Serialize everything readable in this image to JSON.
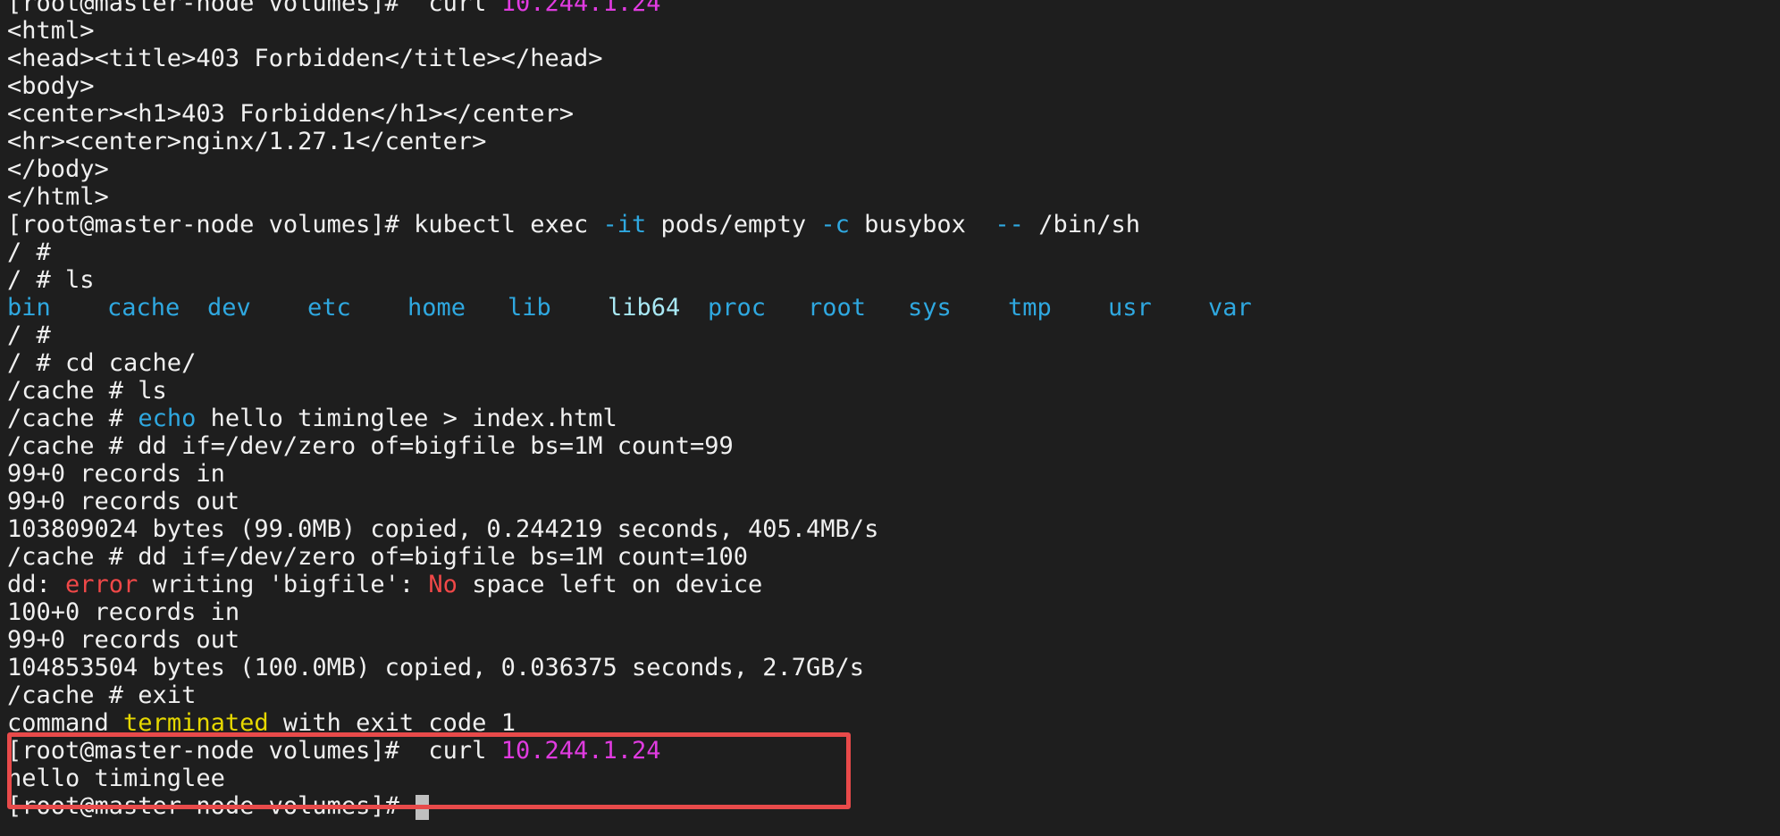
{
  "terminal": {
    "prompt": "[root@master-node volumes]#",
    "colors": {
      "background": "#1e1e1e",
      "text": "#f0f0f0",
      "ip": "#e03be0",
      "flag": "#2fa8e0",
      "error": "#f04848",
      "warning": "#e6d800",
      "highlight_box": "#e84a4a"
    },
    "curl_cmd": "  curl ",
    "ip": "10.244.1.24",
    "html_lines": [
      "<html>",
      "<head><title>403 Forbidden</title></head>",
      "<body>",
      "<center><h1>403 Forbidden</h1></center>",
      "<hr><center>nginx/1.27.1</center>",
      "</body>",
      "</html>"
    ],
    "kubectl": {
      "cmd": " kubectl exec ",
      "flag_it": "-it",
      "pod": " pods/empty ",
      "flag_c": "-c",
      "container": " busybox  ",
      "dashdash": "--",
      "shell": " /bin/sh"
    },
    "root_prompt": "/ #",
    "root_ls": "/ # ls",
    "ls_entries": [
      "bin",
      "cache",
      "dev",
      "etc",
      "home",
      "lib",
      "lib64",
      "proc",
      "root",
      "sys",
      "tmp",
      "usr",
      "var"
    ],
    "cd_cmd": "/ # cd cache/",
    "cache_ls": "/cache # ls",
    "cache_prompt": "/cache # ",
    "echo_kw": "echo",
    "echo_rest": " hello timinglee > index.html",
    "dd1": "/cache # dd if=/dev/zero of=bigfile bs=1M count=99",
    "dd1_in": "99+0 records in",
    "dd1_out": "99+0 records out",
    "dd1_result": "103809024 bytes (99.0MB) copied, 0.244219 seconds, 405.4MB/s",
    "dd2": "/cache # dd if=/dev/zero of=bigfile bs=1M count=100",
    "dd2_prefix": "dd: ",
    "dd2_error_kw": "error",
    "dd2_mid": " writing 'bigfile': ",
    "dd2_no_kw": "No",
    "dd2_suffix": " space left on device",
    "dd2_in": "100+0 records in",
    "dd2_out": "99+0 records out",
    "dd2_result": "104853504 bytes (100.0MB) copied, 0.036375 seconds, 2.7GB/s",
    "exit_cmd": "/cache # exit",
    "cmd_prefix": "command ",
    "terminated_kw": "terminated",
    "cmd_suffix": " with exit code 1",
    "hello_output": "hello timinglee"
  }
}
